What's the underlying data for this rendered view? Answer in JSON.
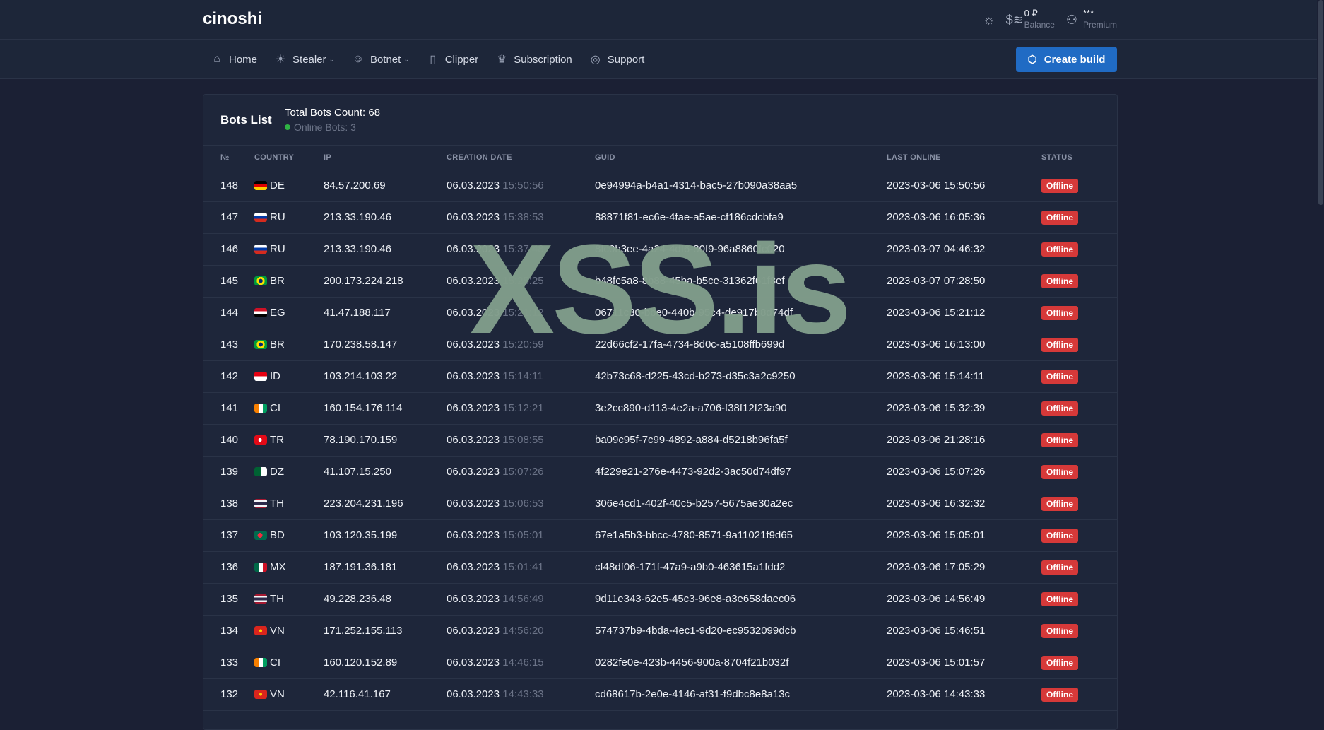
{
  "brand": "cinoshi",
  "header": {
    "theme_icon": "sun-icon",
    "balance_value": "0 ₽",
    "balance_label": "Balance",
    "user_name": "***",
    "user_plan": "Premium"
  },
  "nav": {
    "items": [
      {
        "label": "Home",
        "icon": "home-icon"
      },
      {
        "label": "Stealer",
        "icon": "bug-icon",
        "dropdown": true
      },
      {
        "label": "Botnet",
        "icon": "robot-icon",
        "dropdown": true
      },
      {
        "label": "Clipper",
        "icon": "clipboard-icon"
      },
      {
        "label": "Subscription",
        "icon": "crown-icon"
      },
      {
        "label": "Support",
        "icon": "lifebuoy-icon"
      }
    ],
    "create_build": "Create build"
  },
  "card": {
    "title": "Bots List",
    "total": "Total Bots Count: 68",
    "online": "Online Bots: 3"
  },
  "columns": [
    "№",
    "COUNTRY",
    "IP",
    "CREATION DATE",
    "GUID",
    "LAST ONLINE",
    "STATUS"
  ],
  "rows": [
    [
      "148",
      "DE",
      "84.57.200.69",
      "06.03.2023",
      "15:50:56",
      "0e94994a-b4a1-4314-bac5-27b090a38aa5",
      "2023-03-06 15:50:56",
      "Offline"
    ],
    [
      "147",
      "RU",
      "213.33.190.46",
      "06.03.2023",
      "15:38:53",
      "88871f81-ec6e-4fae-a5ae-cf186cdcbfa9",
      "2023-03-06 16:05:36",
      "Offline"
    ],
    [
      "146",
      "RU",
      "213.33.190.46",
      "06.03.2023",
      "15:37:48",
      "8fc0b3ee-4a24-4df6-80f9-96a8860fc020",
      "2023-03-07 04:46:32",
      "Offline"
    ],
    [
      "145",
      "BR",
      "200.173.224.218",
      "06.03.2023",
      "15:25:25",
      "b48fc5a8-8b88-45ba-b5ce-31362f61f8ef",
      "2023-03-07 07:28:50",
      "Offline"
    ],
    [
      "144",
      "EG",
      "41.47.188.117",
      "06.03.2023",
      "15:21:12",
      "06711c30-bbe0-440b-95c4-de917b8d74df",
      "2023-03-06 15:21:12",
      "Offline"
    ],
    [
      "143",
      "BR",
      "170.238.58.147",
      "06.03.2023",
      "15:20:59",
      "22d66cf2-17fa-4734-8d0c-a5108ffb699d",
      "2023-03-06 16:13:00",
      "Offline"
    ],
    [
      "142",
      "ID",
      "103.214.103.22",
      "06.03.2023",
      "15:14:11",
      "42b73c68-d225-43cd-b273-d35c3a2c9250",
      "2023-03-06 15:14:11",
      "Offline"
    ],
    [
      "141",
      "CI",
      "160.154.176.114",
      "06.03.2023",
      "15:12:21",
      "3e2cc890-d113-4e2a-a706-f38f12f23a90",
      "2023-03-06 15:32:39",
      "Offline"
    ],
    [
      "140",
      "TR",
      "78.190.170.159",
      "06.03.2023",
      "15:08:55",
      "ba09c95f-7c99-4892-a884-d5218b96fa5f",
      "2023-03-06 21:28:16",
      "Offline"
    ],
    [
      "139",
      "DZ",
      "41.107.15.250",
      "06.03.2023",
      "15:07:26",
      "4f229e21-276e-4473-92d2-3ac50d74df97",
      "2023-03-06 15:07:26",
      "Offline"
    ],
    [
      "138",
      "TH",
      "223.204.231.196",
      "06.03.2023",
      "15:06:53",
      "306e4cd1-402f-40c5-b257-5675ae30a2ec",
      "2023-03-06 16:32:32",
      "Offline"
    ],
    [
      "137",
      "BD",
      "103.120.35.199",
      "06.03.2023",
      "15:05:01",
      "67e1a5b3-bbcc-4780-8571-9a11021f9d65",
      "2023-03-06 15:05:01",
      "Offline"
    ],
    [
      "136",
      "MX",
      "187.191.36.181",
      "06.03.2023",
      "15:01:41",
      "cf48df06-171f-47a9-a9b0-463615a1fdd2",
      "2023-03-06 17:05:29",
      "Offline"
    ],
    [
      "135",
      "TH",
      "49.228.236.48",
      "06.03.2023",
      "14:56:49",
      "9d11e343-62e5-45c3-96e8-a3e658daec06",
      "2023-03-06 14:56:49",
      "Offline"
    ],
    [
      "134",
      "VN",
      "171.252.155.113",
      "06.03.2023",
      "14:56:20",
      "574737b9-4bda-4ec1-9d20-ec9532099dcb",
      "2023-03-06 15:46:51",
      "Offline"
    ],
    [
      "133",
      "CI",
      "160.120.152.89",
      "06.03.2023",
      "14:46:15",
      "0282fe0e-423b-4456-900a-8704f21b032f",
      "2023-03-06 15:01:57",
      "Offline"
    ],
    [
      "132",
      "VN",
      "42.116.41.167",
      "06.03.2023",
      "14:43:33",
      "cd68617b-2e0e-4146-af31-f9dbc8e8a13c",
      "2023-03-06 14:43:33",
      "Offline"
    ]
  ],
  "colors": {
    "offline": "#d63939",
    "online": "#2fb344",
    "primary": "#206bc4"
  },
  "watermark": "XSS.is"
}
